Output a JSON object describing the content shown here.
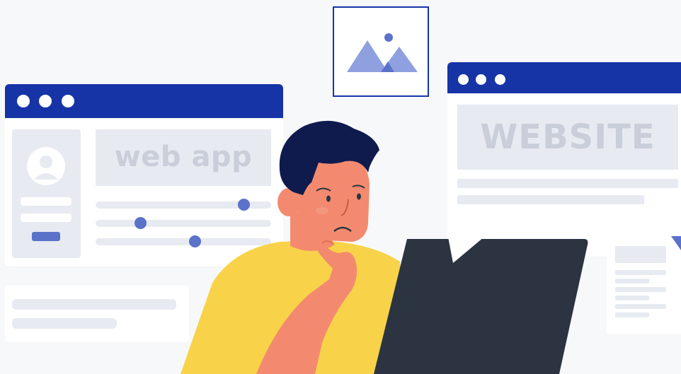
{
  "colors": {
    "background": "#f7f8fa",
    "window_titlebar": "#1634a6",
    "accent": "#5a72c9",
    "placeholder": "#e7eaf0",
    "placeholder_text": "#c9ced9",
    "shirt": "#f8d349",
    "skin": "#f38a6f",
    "hair": "#0f1a4d",
    "laptop": "#2b3440"
  },
  "web_app_window": {
    "hero_text": "web app",
    "sliders": [
      0.87,
      0.24,
      0.57
    ]
  },
  "website_window": {
    "hero_text": "WEBSITE"
  },
  "icons": {
    "image": "image-icon",
    "avatar": "avatar-icon"
  }
}
